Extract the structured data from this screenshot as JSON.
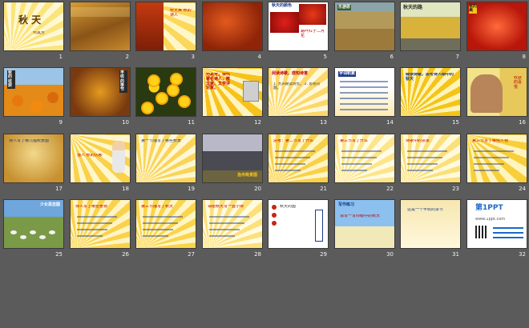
{
  "slides": [
    {
      "num": "1",
      "title": "秋 天",
      "subtitle": "何其芳"
    },
    {
      "num": "2",
      "text": "以下内容仅为本文档的试下载部分"
    },
    {
      "num": "3",
      "text": "秋天美 秋的诗人"
    },
    {
      "num": "4"
    },
    {
      "num": "5",
      "title": "秋天的颜色",
      "note": "霜叶红于二月花"
    },
    {
      "num": "6",
      "title": "乐游原"
    },
    {
      "num": "7",
      "title": "秋天的路"
    },
    {
      "num": "8",
      "title": "秋的美"
    },
    {
      "num": "9",
      "title": "秋的收获"
    },
    {
      "num": "10",
      "title": "丰收的季节"
    },
    {
      "num": "11"
    },
    {
      "num": "12",
      "text": "何其芳，现代著名诗人，散文家、文学评论家。"
    },
    {
      "num": "13",
      "title": "阅读诗歌，感知诗意",
      "text": "1. 大声朗读诗文。 2. 思考问题。"
    },
    {
      "num": "14",
      "title": "字词积累"
    },
    {
      "num": "15",
      "text": "细读诗歌，思考诗人眼中的秋天"
    },
    {
      "num": "16",
      "text": "收获的喜悦"
    },
    {
      "num": "17",
      "text": "诗人写了哪几幅秋景图"
    },
    {
      "num": "18",
      "text": "渔人 秋的忧郁"
    },
    {
      "num": "19",
      "text": "第一节描写了哪些秋景"
    },
    {
      "num": "20",
      "title": "渔舟晚景图"
    },
    {
      "num": "21",
      "text": "思考：第二节写了什么"
    },
    {
      "num": "22",
      "text": "第三节写了什么"
    },
    {
      "num": "23",
      "text": "诗歌中的意象"
    },
    {
      "num": "24",
      "text": "第三节写了哪些人物"
    },
    {
      "num": "25",
      "title": "少女思恋图"
    },
    {
      "num": "26",
      "text": "诗人写了哪些景物"
    },
    {
      "num": "27",
      "text": "第三节描写了秋天"
    },
    {
      "num": "28",
      "text": "请给秋天写一首小诗"
    },
    {
      "num": "29",
      "text": "秋天的图"
    },
    {
      "num": "30",
      "title": "写作练习",
      "text": "请写一写你眼中的秋天"
    },
    {
      "num": "31",
      "text": "这是一个丰收的季节"
    },
    {
      "num": "32",
      "title": "第1PPT",
      "text": "www.1ppt.com"
    }
  ],
  "colors": {
    "background": "#5b5b5b",
    "sunburst_yellow": "#f7c21a",
    "light_yellow": "#fdf0a8",
    "autumn_red": "#c42810",
    "text_red": "#c00000",
    "text_blue": "#1b3a8c"
  }
}
